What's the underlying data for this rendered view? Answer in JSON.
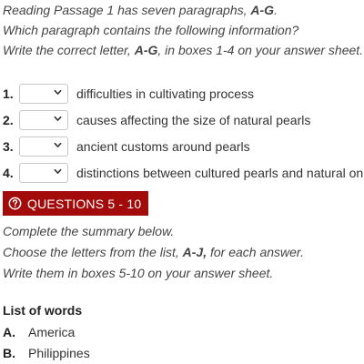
{
  "instructions": {
    "line1_pre": "Reading Passage 1 has seven paragraphs, ",
    "line1_bold": "A-G",
    "line1_post": ".",
    "line2": "Which paragraph contains the following information?",
    "line3_pre": "Write the correct letter, ",
    "line3_bold": "A-G",
    "line3_post": ", in boxes 1-4 on your answer sheet."
  },
  "questions": [
    {
      "number": "1.",
      "value": "",
      "text": "difficulties in cultivating process"
    },
    {
      "number": "2.",
      "value": "",
      "text": "causes affecting the size of natural pearls"
    },
    {
      "number": "3.",
      "value": "",
      "text": "ancient customs around pearls"
    },
    {
      "number": "4.",
      "value": "",
      "text": "distinctions between cultured pearls and natural on"
    }
  ],
  "section": {
    "label": "QUESTIONS 5 - 10",
    "icon": "question-circle-icon",
    "color": "#a30b0b"
  },
  "summary": {
    "line1": "Complete the summary below.",
    "line2_pre": "Choose the letters from the list, ",
    "line2_bold": "A-J,",
    "line2_post": " for each answer.",
    "line3": "Write them in boxes 5-10 on your answer sheet."
  },
  "word_list": {
    "title": "List of words",
    "items": [
      {
        "letter": "A.",
        "word": "America"
      },
      {
        "letter": "B.",
        "word": "Philippines"
      }
    ]
  }
}
